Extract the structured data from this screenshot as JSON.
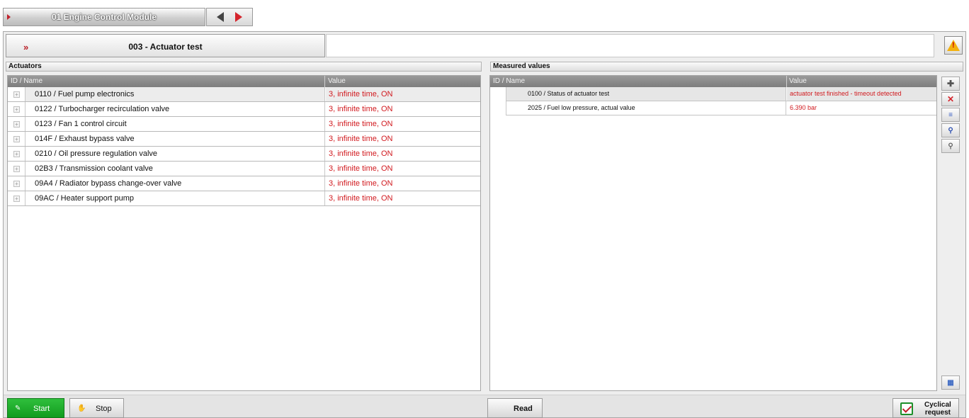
{
  "module": {
    "label": "01 Engine Control Module",
    "nav_prev": "previous",
    "nav_next": "next"
  },
  "title": {
    "chevron": "»",
    "text": "003 - Actuator test"
  },
  "icons": {
    "warning": "warning-icon",
    "add": "add-icon",
    "delete": "delete-icon",
    "delete_all": "delete-all-icon",
    "search": "binoculars-icon",
    "search_next": "binoculars-next-icon",
    "graph": "graph-icon",
    "start": "start-icon",
    "stop": "stop-icon"
  },
  "colors": {
    "value_red": "#d11a1f",
    "start_green": "#1aa629",
    "warning_yellow": "#f3b10f"
  },
  "actuators": {
    "header": "Actuators",
    "columns": [
      "ID / Name",
      "Value"
    ],
    "rows": [
      {
        "name": "0110 / Fuel pump electronics",
        "value": "3, infinite time, ON"
      },
      {
        "name": "0122 / Turbocharger recirculation valve",
        "value": "3, infinite time, ON"
      },
      {
        "name": "0123 / Fan 1 control circuit",
        "value": "3, infinite time, ON"
      },
      {
        "name": "014F / Exhaust bypass valve",
        "value": "3, infinite time, ON"
      },
      {
        "name": "0210 / Oil pressure regulation valve",
        "value": "3, infinite time, ON"
      },
      {
        "name": "02B3 / Transmission coolant valve",
        "value": "3, infinite time, ON"
      },
      {
        "name": "09A4 / Radiator bypass change-over valve",
        "value": "3, infinite time, ON"
      },
      {
        "name": "09AC / Heater support pump",
        "value": "3, infinite time, ON"
      }
    ]
  },
  "measured": {
    "header": "Measured values",
    "columns": [
      "ID / Name",
      "Value"
    ],
    "rows": [
      {
        "name": "0100 / Status of actuator test",
        "value": "actuator test finished - timeout detected"
      },
      {
        "name": "2025 / Fuel low pressure, actual value",
        "value": "6.390 bar"
      }
    ]
  },
  "footer": {
    "start": "Start",
    "stop": "Stop",
    "read": "Read",
    "cyclical_line1": "Cyclical",
    "cyclical_line2": "request"
  }
}
